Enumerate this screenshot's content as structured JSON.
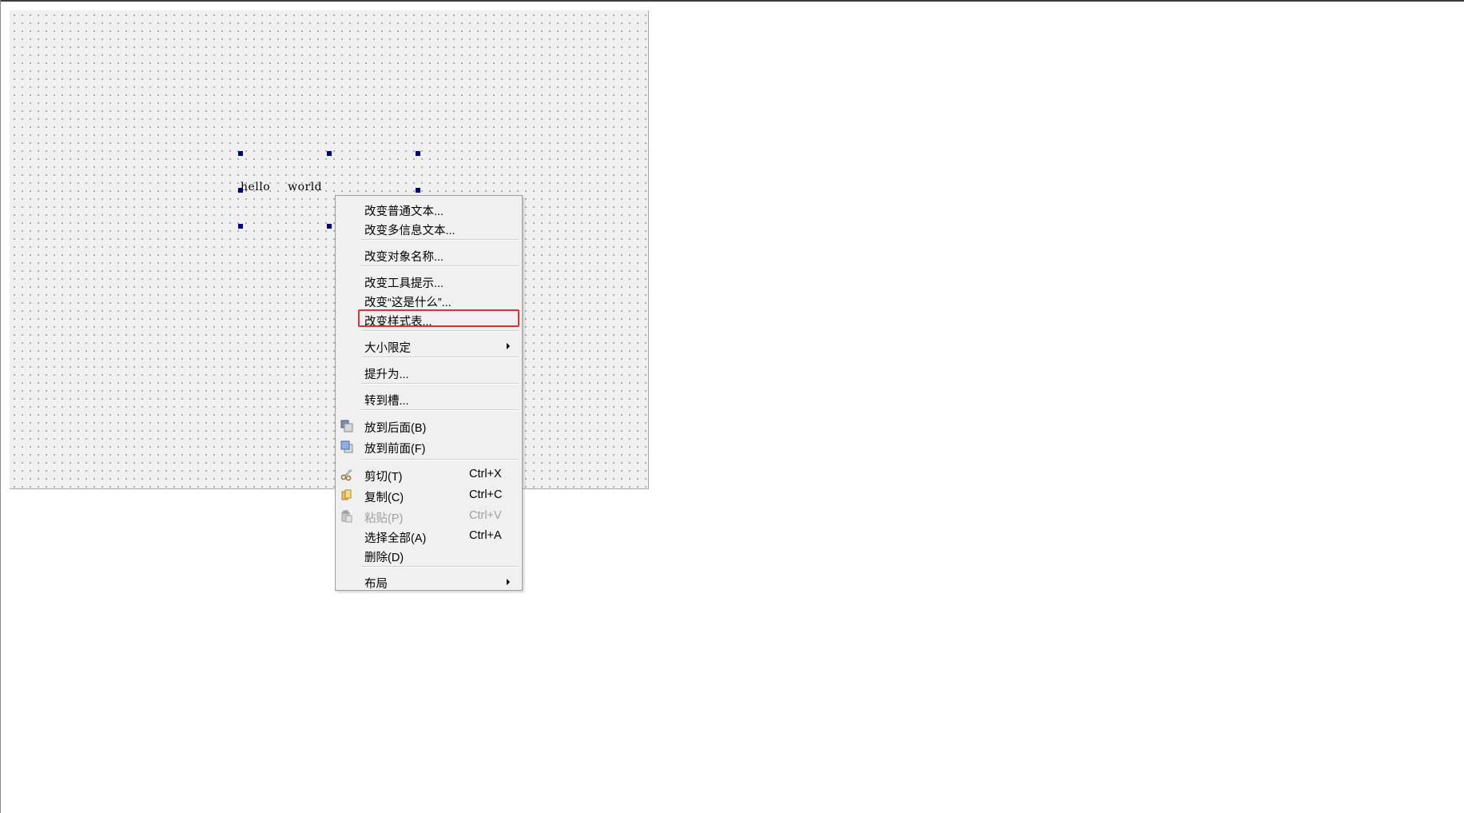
{
  "canvas": {
    "label_text": "hello  world"
  },
  "menu": {
    "items": [
      {
        "label": "改变普通文本...",
        "shortcut": "",
        "disabled": false
      },
      {
        "label": "改变多信息文本...",
        "shortcut": "",
        "disabled": false
      },
      {
        "label": "改变对象名称...",
        "shortcut": "",
        "disabled": false
      },
      {
        "label": "改变工具提示...",
        "shortcut": "",
        "disabled": false
      },
      {
        "label": "改变“这是什么”...",
        "shortcut": "",
        "disabled": false
      },
      {
        "label": "改变样式表...",
        "shortcut": "",
        "disabled": false
      },
      {
        "label": "大小限定",
        "shortcut": "",
        "disabled": false
      },
      {
        "label": "提升为...",
        "shortcut": "",
        "disabled": false
      },
      {
        "label": "转到槽...",
        "shortcut": "",
        "disabled": false
      },
      {
        "label": "放到后面(B)",
        "shortcut": "",
        "disabled": false
      },
      {
        "label": "放到前面(F)",
        "shortcut": "",
        "disabled": false
      },
      {
        "label": "剪切(T)",
        "shortcut": "Ctrl+X",
        "disabled": false
      },
      {
        "label": "复制(C)",
        "shortcut": "Ctrl+C",
        "disabled": false
      },
      {
        "label": "粘贴(P)",
        "shortcut": "Ctrl+V",
        "disabled": true
      },
      {
        "label": "选择全部(A)",
        "shortcut": "Ctrl+A",
        "disabled": false
      },
      {
        "label": "删除(D)",
        "shortcut": "",
        "disabled": false
      },
      {
        "label": "布局",
        "shortcut": "",
        "disabled": false
      }
    ]
  },
  "colors": {
    "selection_handle": "#000080",
    "highlight_border": "#e03030",
    "menu_background": "#f0f0f0",
    "disabled_text": "#a0a0a0"
  }
}
